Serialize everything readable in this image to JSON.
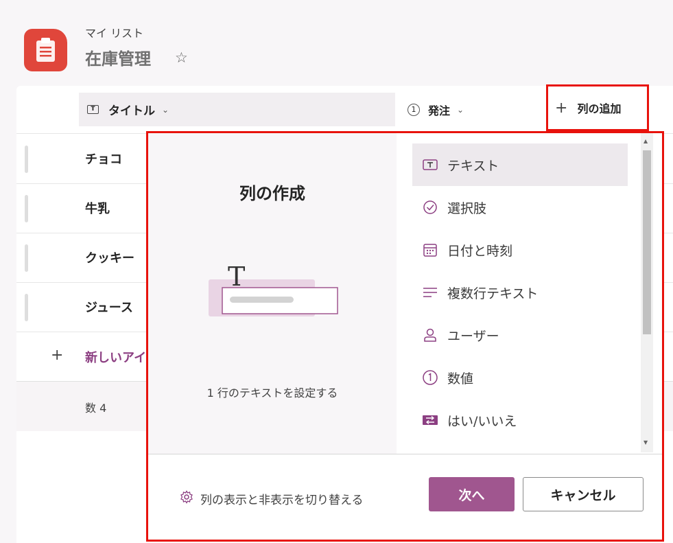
{
  "header": {
    "site_name": "マイ リスト",
    "list_title": "在庫管理"
  },
  "columns": {
    "title_label": "タイトル",
    "order_label": "発注",
    "order_icon_text": "1",
    "title_icon_text": "T",
    "add_column_label": "列の追加"
  },
  "rows": [
    {
      "title": "チョコ"
    },
    {
      "title": "牛乳"
    },
    {
      "title": "クッキー"
    },
    {
      "title": "ジュース"
    }
  ],
  "new_item_label": "新しいアイテム",
  "count_label": "数 4",
  "panel": {
    "title": "列の作成",
    "description": "1 行のテキストを設定する",
    "types": [
      {
        "label": "テキスト",
        "icon": "text-icon",
        "selected": true
      },
      {
        "label": "選択肢",
        "icon": "choice-icon",
        "selected": false
      },
      {
        "label": "日付と時刻",
        "icon": "calendar-icon",
        "selected": false
      },
      {
        "label": "複数行テキスト",
        "icon": "multiline-icon",
        "selected": false
      },
      {
        "label": "ユーザー",
        "icon": "person-icon",
        "selected": false
      },
      {
        "label": "数値",
        "icon": "number-icon",
        "selected": false
      },
      {
        "label": "はい/いいえ",
        "icon": "yes-no-icon",
        "selected": false
      }
    ],
    "toggle_columns_label": "列の表示と非表示を切り替える",
    "next_label": "次へ",
    "cancel_label": "キャンセル"
  },
  "colors": {
    "accent": "#a0568f",
    "app_logo": "#e0463b",
    "highlight": "#e8120c"
  }
}
